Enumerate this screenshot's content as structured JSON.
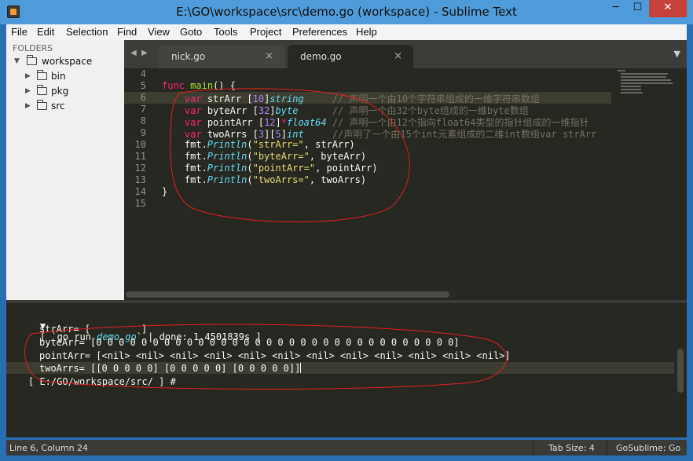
{
  "window": {
    "title": "E:\\GO\\workspace\\src\\demo.go (workspace) - Sublime Text",
    "minimize_glyph": "─",
    "maximize_glyph": "☐",
    "close_glyph": "✕"
  },
  "menu": [
    "File",
    "Edit",
    "Selection",
    "Find",
    "View",
    "Goto",
    "Tools",
    "Project",
    "Preferences",
    "Help"
  ],
  "sidebar": {
    "header": "FOLDERS",
    "root": "workspace",
    "children": [
      "bin",
      "pkg",
      "src"
    ]
  },
  "tabs": [
    {
      "label": "nick.go",
      "close": "×"
    },
    {
      "label": "demo.go",
      "close": "×"
    }
  ],
  "tab_nav": {
    "left": "◀",
    "right": "▶",
    "dropdown": "▼"
  },
  "editor": {
    "line_numbers": [
      "4",
      "5",
      "6",
      "7",
      "8",
      "9",
      "10",
      "11",
      "12",
      "13",
      "14",
      "15"
    ],
    "lines": [
      [],
      [
        {
          "t": "func",
          "c": "kw"
        },
        {
          "t": " ",
          "c": ""
        },
        {
          "t": "main",
          "c": "fn"
        },
        {
          "t": "() {",
          "c": ""
        }
      ],
      [
        {
          "t": "    ",
          "c": ""
        },
        {
          "t": "var",
          "c": "kw"
        },
        {
          "t": " strArr [",
          "c": ""
        },
        {
          "t": "10",
          "c": "num"
        },
        {
          "t": "]",
          "c": ""
        },
        {
          "t": "string",
          "c": "type"
        },
        {
          "t": "     ",
          "c": ""
        },
        {
          "t": "// 声明一个由10个字符串组成的一维字符串数组",
          "c": "cmt"
        }
      ],
      [
        {
          "t": "    ",
          "c": ""
        },
        {
          "t": "var",
          "c": "kw"
        },
        {
          "t": " byteArr [",
          "c": ""
        },
        {
          "t": "32",
          "c": "num"
        },
        {
          "t": "]",
          "c": ""
        },
        {
          "t": "byte",
          "c": "type"
        },
        {
          "t": "      ",
          "c": ""
        },
        {
          "t": "// 声明一个由32个byte组成的一维byte数组",
          "c": "cmt"
        }
      ],
      [
        {
          "t": "    ",
          "c": ""
        },
        {
          "t": "var",
          "c": "kw"
        },
        {
          "t": " pointArr [",
          "c": ""
        },
        {
          "t": "12",
          "c": "num"
        },
        {
          "t": "]",
          "c": ""
        },
        {
          "t": "*",
          "c": "kw"
        },
        {
          "t": "float64",
          "c": "type"
        },
        {
          "t": " ",
          "c": ""
        },
        {
          "t": "// 声明一个由12个指向float64类型的指针组成的一维指针",
          "c": "cmt"
        }
      ],
      [
        {
          "t": "    ",
          "c": ""
        },
        {
          "t": "var",
          "c": "kw"
        },
        {
          "t": " twoArrs [",
          "c": ""
        },
        {
          "t": "3",
          "c": "num"
        },
        {
          "t": "][",
          "c": ""
        },
        {
          "t": "5",
          "c": "num"
        },
        {
          "t": "]",
          "c": ""
        },
        {
          "t": "int",
          "c": "type"
        },
        {
          "t": "     ",
          "c": ""
        },
        {
          "t": "//声明了一个由15个int元素组成的二维int数组var strArr",
          "c": "cmt"
        }
      ],
      [
        {
          "t": "    fmt.",
          "c": ""
        },
        {
          "t": "Println",
          "c": "type"
        },
        {
          "t": "(",
          "c": ""
        },
        {
          "t": "\"strArr=\"",
          "c": "str"
        },
        {
          "t": ", strArr)",
          "c": ""
        }
      ],
      [
        {
          "t": "    fmt.",
          "c": ""
        },
        {
          "t": "Println",
          "c": "type"
        },
        {
          "t": "(",
          "c": ""
        },
        {
          "t": "\"byteArr=\"",
          "c": "str"
        },
        {
          "t": ", byteArr)",
          "c": ""
        }
      ],
      [
        {
          "t": "    fmt.",
          "c": ""
        },
        {
          "t": "Println",
          "c": "type"
        },
        {
          "t": "(",
          "c": ""
        },
        {
          "t": "\"pointArr=\"",
          "c": "str"
        },
        {
          "t": ", pointArr)",
          "c": ""
        }
      ],
      [
        {
          "t": "    fmt.",
          "c": ""
        },
        {
          "t": "Println",
          "c": "type"
        },
        {
          "t": "(",
          "c": ""
        },
        {
          "t": "\"twoArrs=\"",
          "c": "str"
        },
        {
          "t": ", twoArrs)",
          "c": ""
        }
      ],
      [
        {
          "t": "}",
          "c": ""
        }
      ],
      []
    ]
  },
  "output": {
    "fold_arrow": "▼",
    "run_prefix": "[ `go run ",
    "run_file": "demo.go",
    "run_suffix": "` | done: 1.4501839s ]",
    "lines": [
      "strArr= [         ]",
      "byteArr= [0 0 0 0 0 0 0 0 0 0 0 0 0 0 0 0 0 0 0 0 0 0 0 0 0 0 0 0 0 0 0 0]",
      "pointArr= [<nil> <nil> <nil> <nil> <nil> <nil> <nil> <nil> <nil> <nil> <nil> <nil>]",
      "twoArrs= [[0 0 0 0 0] [0 0 0 0 0] [0 0 0 0 0]]"
    ],
    "prompt": "[ E:/GO/workspace/src/ ] #"
  },
  "status": {
    "position": "Line 6, Column 24",
    "tab_size": "Tab Size: 4",
    "syntax": "GoSublime: Go"
  },
  "colors": {
    "background": "#272822",
    "annotation": "#e02020",
    "title_bar": "#4f9bd9"
  }
}
